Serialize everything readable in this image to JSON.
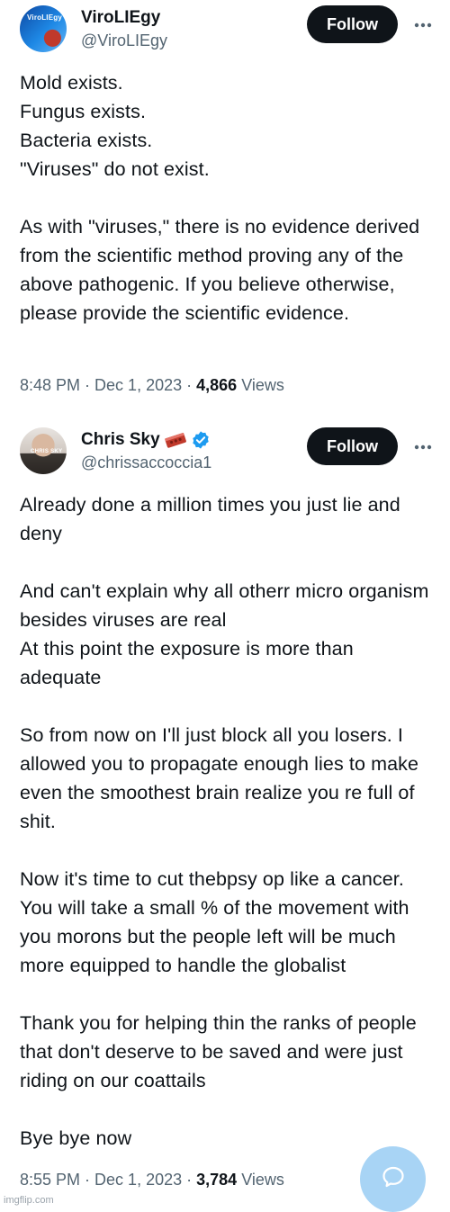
{
  "tweet1": {
    "display_name": "ViroLIEgy",
    "handle": "@ViroLIEgy",
    "avatar_text": "ViroLIEgy",
    "follow_label": "Follow",
    "body": "Mold exists.\nFungus exists.\nBacteria exists.\n\"Viruses\" do not exist.\n\nAs with \"viruses,\" there is no evidence derived from the scientific method proving any of the above pathogenic. If you believe otherwise, please provide the scientific evidence.",
    "time": "8:48 PM",
    "date": "Dec 1, 2023",
    "views_count": "4,866",
    "views_label": "Views"
  },
  "tweet2": {
    "display_name": "Chris Sky",
    "handle": "@chrissaccoccia1",
    "avatar_text": "CHRIS SKY",
    "follow_label": "Follow",
    "badges": [
      "brick-icon",
      "verified-icon"
    ],
    "body": "Already done a million times you just lie and deny\n\nAnd can't explain why all otherr micro organism besides viruses are real\nAt this point the exposure is more than adequate\n\nSo from now on I'll just block all you losers. I allowed you to propagate enough lies to make even the smoothest brain realize you re full of shit.\n\nNow it's time to cut thebpsy op like a cancer. You will take a small % of the movement with you morons but the people left will be much more equipped to handle the globalist\n\nThank you for helping thin the ranks of people that don't deserve to be saved and were just riding on our coattails\n\nBye bye  now",
    "time": "8:55 PM",
    "date": "Dec 1, 2023",
    "views_count": "3,784",
    "views_label": "Views"
  },
  "separator": " · ",
  "watermark": "imgflip.com",
  "colors": {
    "text": "#0f1419",
    "secondary": "#536471",
    "button_bg": "#0f1419",
    "verified": "#1d9bf0",
    "fab": "#a8d4f5"
  }
}
